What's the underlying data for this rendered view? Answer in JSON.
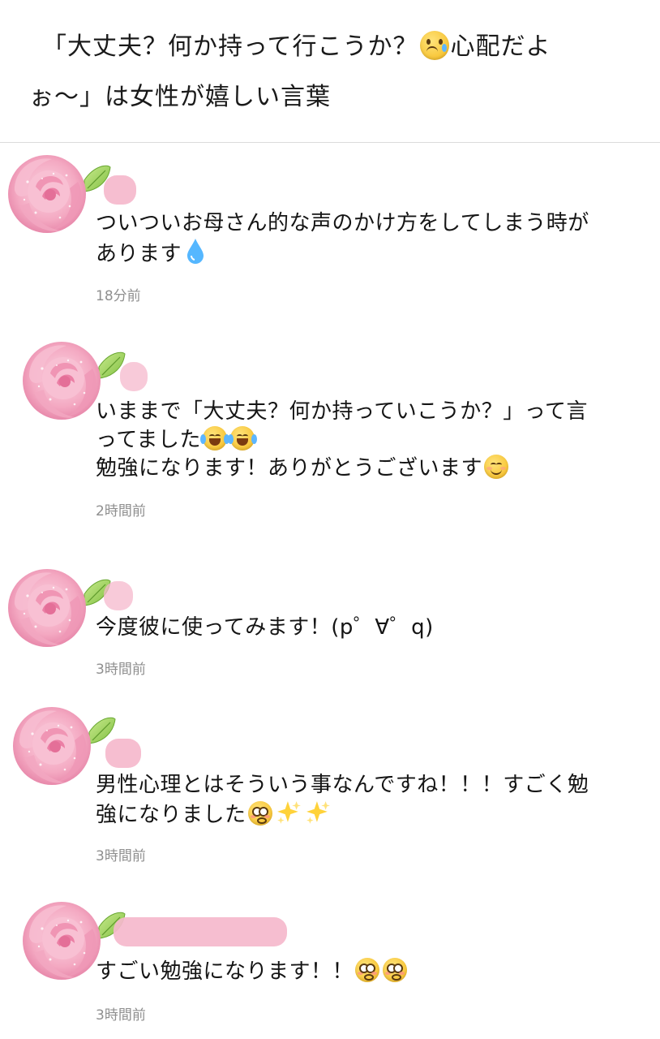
{
  "header": {
    "title_line1": "「大丈夫？何か持って行こうか？",
    "title_line1_end": "心配だよ",
    "title_line2": "ぉ〜」は女性が嬉しい言葉",
    "title_emoji": "crying-face-icon"
  },
  "comments": [
    {
      "avatar": "pink-rose-icon",
      "lines": [
        "ついついお母さん的な声のかけ方をしてしまう時が",
        "あります"
      ],
      "trailing_icon": "droplet-icon",
      "timestamp": "18分前"
    },
    {
      "avatar": "pink-rose-icon",
      "lines": [
        "いままで「大丈夫？何か持っていこうか？」って言",
        "ってました",
        "勉強になります！ありがとうございます"
      ],
      "icons": [
        "face-with-tears-of-joy-icon",
        "face-with-tears-of-joy-icon",
        "smiling-face-icon"
      ],
      "timestamp": "2時間前"
    },
    {
      "avatar": "pink-rose-icon",
      "lines": [
        "今度彼に使ってみます！(p゜∀゜q)"
      ],
      "timestamp": "3時間前"
    },
    {
      "avatar": "pink-rose-icon",
      "lines": [
        "男性心理とはそういう事なんですね！！！すごく勉",
        "強になりました"
      ],
      "icons": [
        "flushed-face-icon",
        "sparkles-icon",
        "sparkles-icon"
      ],
      "timestamp": "3時間前"
    },
    {
      "avatar": "pink-rose-icon",
      "lines": [
        "すごい勉強になります！！"
      ],
      "icons": [
        "flushed-face-icon",
        "flushed-face-icon"
      ],
      "timestamp": "3時間前"
    }
  ],
  "colors": {
    "rose": "#f4a9c2",
    "rose_dark": "#e67aa0",
    "leaf": "#9acd5a",
    "name_blur": "#f5b8cc",
    "timestamp": "#8f8f8f",
    "divider": "#dcdcdc"
  }
}
